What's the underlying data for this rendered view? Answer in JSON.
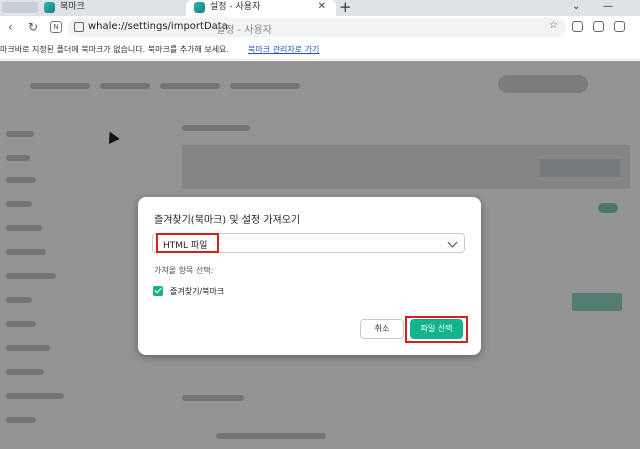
{
  "tabs": [
    {
      "label": "북마크"
    },
    {
      "label": "설정 - 사용자",
      "active": true
    }
  ],
  "address_bar": {
    "url": "whale://settings/importData",
    "page_title": "설정 - 사용자"
  },
  "bookmarks_bar": {
    "message": "마크바로 지정된 폴더에 북마크가 없습니다. 북마크를 추가해 보세요.",
    "link": "북마크 관리자로 가기"
  },
  "dialog": {
    "title": "즐겨찾기(북마크) 및 설정 가져오기",
    "source_select": {
      "value": "HTML 파일"
    },
    "items_label": "가져올 항목 선택:",
    "checkbox": {
      "label": "즐겨찾기/북마크",
      "checked": true
    },
    "cancel_label": "취소",
    "choose_file_label": "파일 선택"
  },
  "colors": {
    "accent": "#12b48e",
    "highlight": "#d62020"
  }
}
